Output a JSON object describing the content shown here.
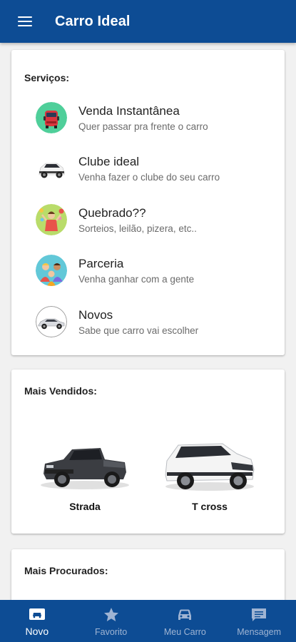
{
  "app": {
    "title": "Carro Ideal",
    "colors": {
      "primary": "#0d4c94",
      "nav_inactive": "#9fb4d3",
      "nav_active": "#ffffff"
    }
  },
  "services": {
    "heading": "Serviços:",
    "items": [
      {
        "title": "Venda Instantânea",
        "subtitle": "Quer passar pra frente o carro",
        "icon": "red-car-icon"
      },
      {
        "title": "Clube ideal",
        "subtitle": "Venha fazer o clube do seu carro",
        "icon": "white-suv-icon"
      },
      {
        "title": "Quebrado??",
        "subtitle": "Sorteios, leilão, pizera, etc..",
        "icon": "party-icon"
      },
      {
        "title": "Parceria",
        "subtitle": "Venha ganhar com a gente",
        "icon": "partners-icon"
      },
      {
        "title": "Novos",
        "subtitle": "Sabe que carro vai escolher",
        "icon": "silver-car-icon"
      }
    ]
  },
  "best_sellers": {
    "heading": "Mais Vendidos:",
    "cars": [
      {
        "name": "Strada",
        "color": "#3b3d42"
      },
      {
        "name": "T cross",
        "color": "#f4f4f4"
      }
    ]
  },
  "most_searched": {
    "heading": "Mais Procurados:"
  },
  "bottom_nav": [
    {
      "label": "Novo",
      "icon": "car-front-card-icon",
      "active": true
    },
    {
      "label": "Favorito",
      "icon": "star-icon",
      "active": false
    },
    {
      "label": "Meu Carro",
      "icon": "car-icon",
      "active": false
    },
    {
      "label": "Mensagem",
      "icon": "chat-icon",
      "active": false
    }
  ]
}
